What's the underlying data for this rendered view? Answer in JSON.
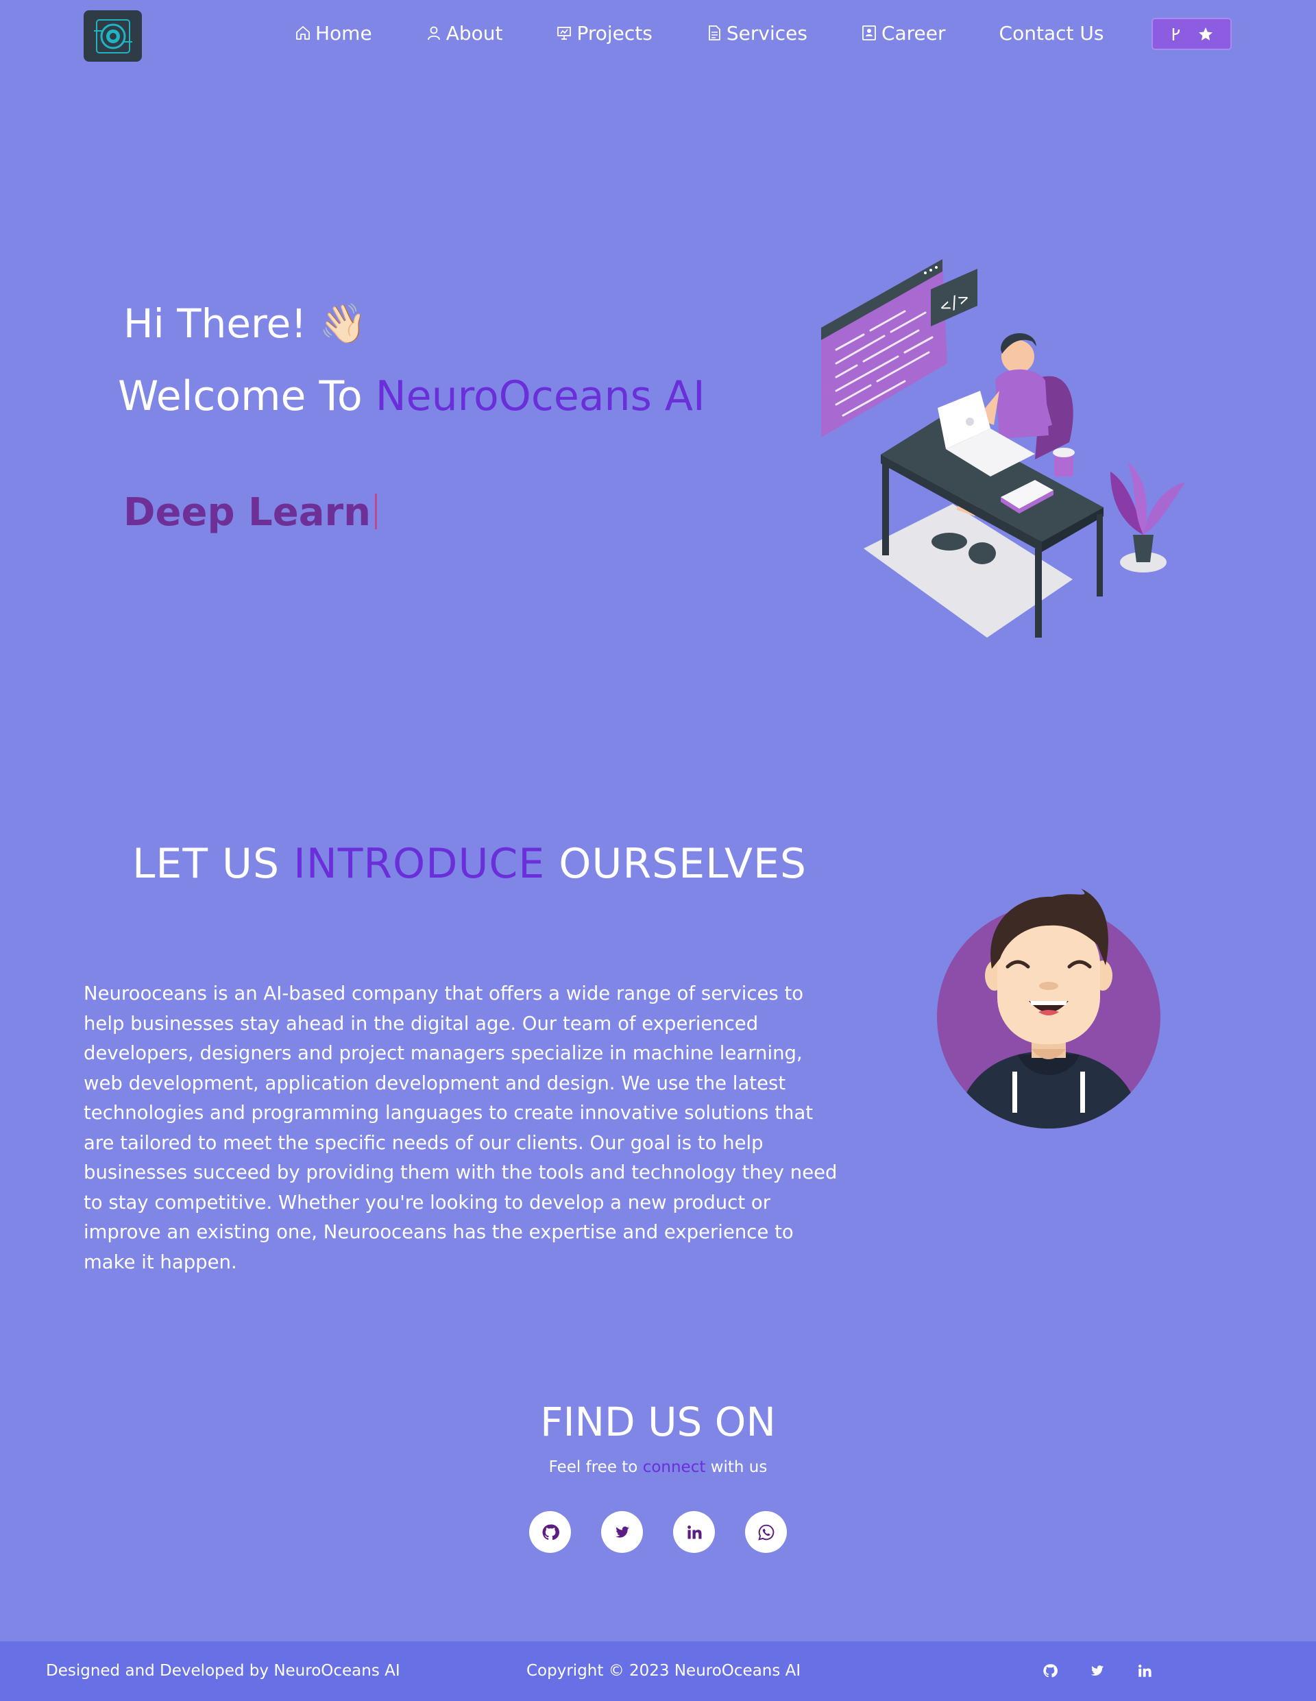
{
  "nav": {
    "items": [
      {
        "label": "Home",
        "icon": "home-icon"
      },
      {
        "label": "About",
        "icon": "user-icon"
      },
      {
        "label": "Projects",
        "icon": "presentation-icon"
      },
      {
        "label": "Services",
        "icon": "document-icon"
      },
      {
        "label": "Career",
        "icon": "badge-icon"
      },
      {
        "label": "Contact Us",
        "icon": ""
      }
    ],
    "fork_button_icons": [
      "fork-icon",
      "star-icon"
    ]
  },
  "hero": {
    "greeting": "Hi There!",
    "greeting_emoji": "👋🏻",
    "welcome_prefix": "Welcome To",
    "welcome_brand": "NeuroOceans AI",
    "typed_text": "Deep Learn"
  },
  "about": {
    "title_part1": "LET US",
    "title_accent": "INTRODUCE",
    "title_part2": "OURSELVES",
    "body": "Neurooceans is an AI-based company that offers a wide range of services to help businesses stay ahead in the digital age. Our team of experienced developers, designers and project managers specialize in machine learning, web development, application development and design. We use the latest technologies and programming languages to create innovative solutions that are tailored to meet the specific needs of our clients. Our goal is to help businesses succeed by providing them with the tools and technology they need to stay competitive. Whether you're looking to develop a new product or improve an existing one, Neurooceans has the expertise and experience to make it happen."
  },
  "find": {
    "title": "FIND US ON",
    "sub_prefix": "Feel free to",
    "sub_accent": "connect",
    "sub_suffix": "with us",
    "socials": [
      "github-icon",
      "twitter-icon",
      "linkedin-icon",
      "whatsapp-icon"
    ]
  },
  "footer": {
    "left": "Designed and Developed by NeuroOceans AI",
    "center": "Copyright © 2023 NeuroOceans AI",
    "icons": [
      "github-icon",
      "twitter-icon",
      "linkedin-icon"
    ]
  },
  "colors": {
    "background": "#7f86e6",
    "accent_purple": "#6a2fd8",
    "typed_text": "#6e2f97",
    "footer_bg": "#6771e5",
    "icon_purple": "#5c1d83"
  }
}
